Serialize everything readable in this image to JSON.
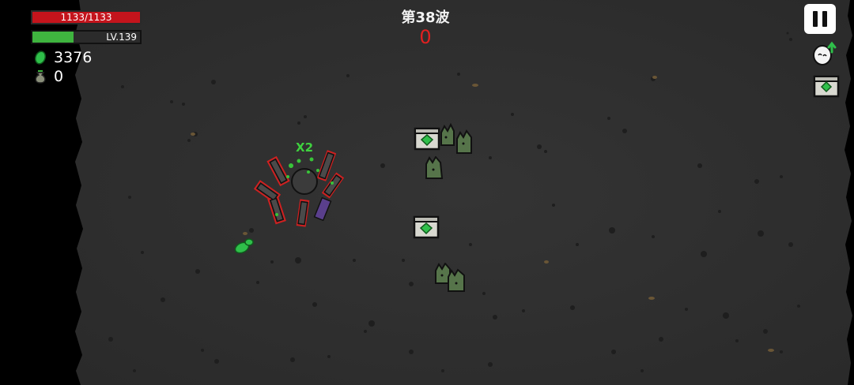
{
  "hud": {
    "hp_text": "1133/1133",
    "hp_fraction": 1.0,
    "level_text": "LV.139",
    "xp_fraction": 0.38,
    "gems": "3376",
    "bags": "0"
  },
  "wave": {
    "title": "第38波",
    "count": "0"
  },
  "player": {
    "multiplier": "X2"
  },
  "colors": {
    "hp": "#c4141c",
    "xp": "#3fb43f",
    "wave_count": "#e02020",
    "floor": "#2e2e2e",
    "enemy": "#56744a",
    "chest_gem": "#2fbf4a"
  },
  "icons": {
    "pause": "pause-icon",
    "gem": "green-gem-icon",
    "bag": "money-bag-icon",
    "egg": "egg-upgrade-icon",
    "chest": "supply-chest-icon"
  }
}
